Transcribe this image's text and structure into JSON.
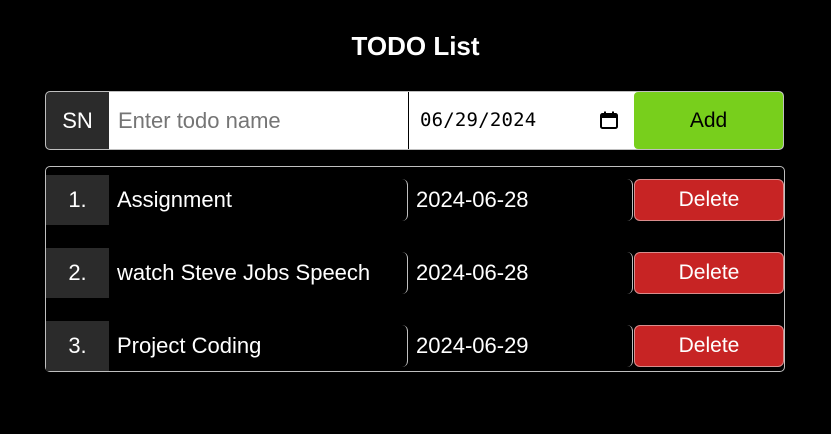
{
  "title": "TODO List",
  "input_row": {
    "sn_label": "SN",
    "name_placeholder": "Enter todo name",
    "name_value": "",
    "date_value": "06/29/2024",
    "add_label": "Add"
  },
  "todos": [
    {
      "number": "1.",
      "name": "Assignment",
      "date": "2024-06-28",
      "delete_label": "Delete"
    },
    {
      "number": "2.",
      "name": "watch Steve Jobs Speech",
      "date": "2024-06-28",
      "delete_label": "Delete"
    },
    {
      "number": "3.",
      "name": "Project Coding",
      "date": "2024-06-29",
      "delete_label": "Delete"
    }
  ],
  "icons": {
    "date_picker": "calendar-icon"
  },
  "colors": {
    "background": "#000000",
    "add_button": "#78cf1c",
    "delete_button": "#c72424",
    "number_cell": "#2b2b2b"
  }
}
